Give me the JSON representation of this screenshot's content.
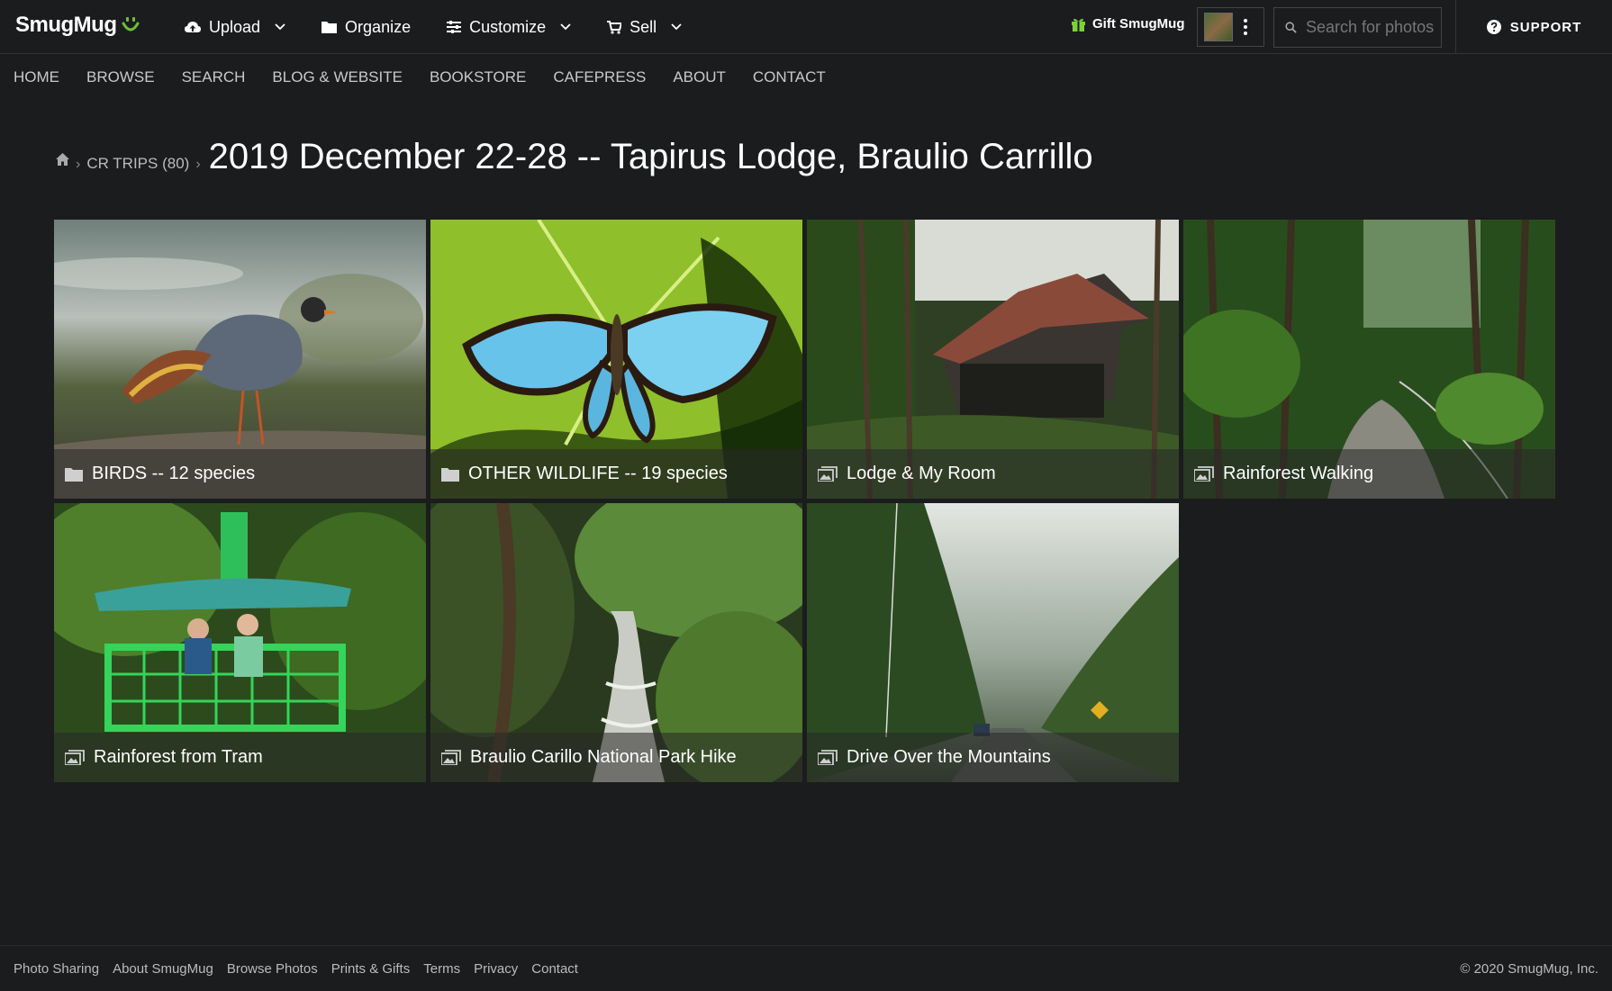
{
  "brand": {
    "name": "SmugMug"
  },
  "topnav": [
    {
      "label": "Upload",
      "icon": "cloud-upload-icon",
      "has_menu": true
    },
    {
      "label": "Organize",
      "icon": "folder-icon",
      "has_menu": false
    },
    {
      "label": "Customize",
      "icon": "sliders-icon",
      "has_menu": true
    },
    {
      "label": "Sell",
      "icon": "cart-icon",
      "has_menu": true
    }
  ],
  "gift": {
    "label": "Gift SmugMug"
  },
  "search": {
    "placeholder": "Search for photos"
  },
  "support": {
    "label": "SUPPORT"
  },
  "sitenav": [
    "HOME",
    "BROWSE",
    "SEARCH",
    "BLOG & WEBSITE",
    "BOOKSTORE",
    "CAFEPRESS",
    "ABOUT",
    "CONTACT"
  ],
  "breadcrumb": {
    "parent": "CR TRIPS (80)"
  },
  "page": {
    "title": "2019 December 22-28 -- Tapirus Lodge, Braulio Carrillo"
  },
  "tiles": [
    {
      "label": "BIRDS -- 12 species",
      "type": "folder"
    },
    {
      "label": "OTHER WILDLIFE -- 19 species",
      "type": "folder"
    },
    {
      "label": "Lodge & My Room",
      "type": "gallery"
    },
    {
      "label": "Rainforest Walking",
      "type": "gallery"
    },
    {
      "label": "Rainforest from Tram",
      "type": "gallery"
    },
    {
      "label": "Braulio Carillo National Park Hike",
      "type": "gallery"
    },
    {
      "label": "Drive Over the Mountains",
      "type": "gallery"
    }
  ],
  "footer": {
    "links": [
      "Photo Sharing",
      "About SmugMug",
      "Browse Photos",
      "Prints & Gifts",
      "Terms",
      "Privacy",
      "Contact"
    ],
    "copyright": "© 2020 SmugMug, Inc."
  },
  "colors": {
    "background": "#1b1c1e",
    "brand_green": "#6dbf3b",
    "gift_green": "#7bd13a"
  }
}
